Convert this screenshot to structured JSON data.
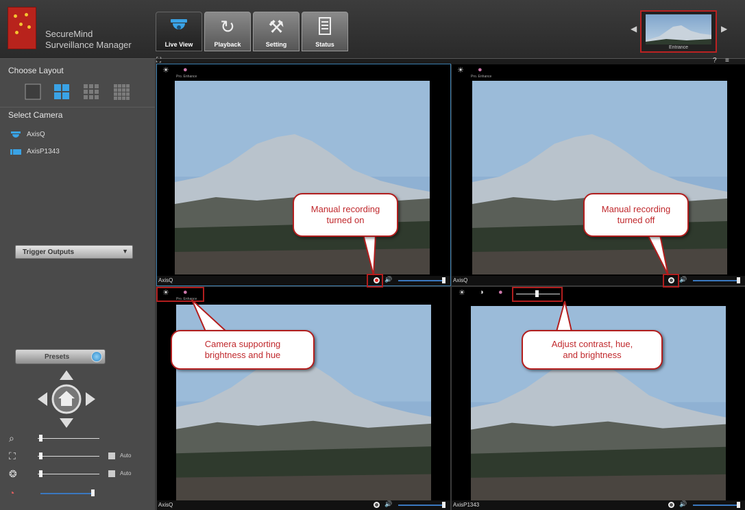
{
  "app": {
    "name_line1": "SecureMind",
    "name_line2": "Surveillance Manager"
  },
  "nav": [
    {
      "label": "Live View",
      "icon": "camera-dome-icon",
      "active": true
    },
    {
      "label": "Playback",
      "icon": "refresh-icon",
      "active": false
    },
    {
      "label": "Setting",
      "icon": "tools-icon",
      "active": false
    },
    {
      "label": "Status",
      "icon": "document-icon",
      "active": false
    }
  ],
  "thumbnail": {
    "caption": "Entrance"
  },
  "sidebar": {
    "layout_title": "Choose Layout",
    "camera_title": "Select Camera",
    "cameras": [
      "AxisQ",
      "AxisP1343"
    ],
    "trigger_outputs": "Trigger Outputs",
    "presets": "Presets",
    "auto_label": "Auto"
  },
  "panels": [
    {
      "camera": "AxisQ",
      "sub_label": "Pro. Enhance",
      "recording": "on"
    },
    {
      "camera": "AxisQ",
      "sub_label": "Pro. Enhance",
      "recording": "off"
    },
    {
      "camera": "AxisQ",
      "sub_label": "Pro. Enhance",
      "recording": "off"
    },
    {
      "camera": "AxisP1343",
      "sub_label": "",
      "recording": "off"
    }
  ],
  "callouts": {
    "rec_on_line1": "Manual recording",
    "rec_on_line2": "turned on",
    "rec_off_line1": "Manual recording",
    "rec_off_line2": "turned off",
    "bright_line1": "Camera supporting",
    "bright_line2": "brightness and hue",
    "adjust_line1": "Adjust contrast, hue,",
    "adjust_line2": "and brightness"
  },
  "colors": {
    "accent": "#3aa3e6",
    "callout_border": "#b21e1e",
    "callout_text": "#c0282c",
    "record_on": "#e02020"
  }
}
